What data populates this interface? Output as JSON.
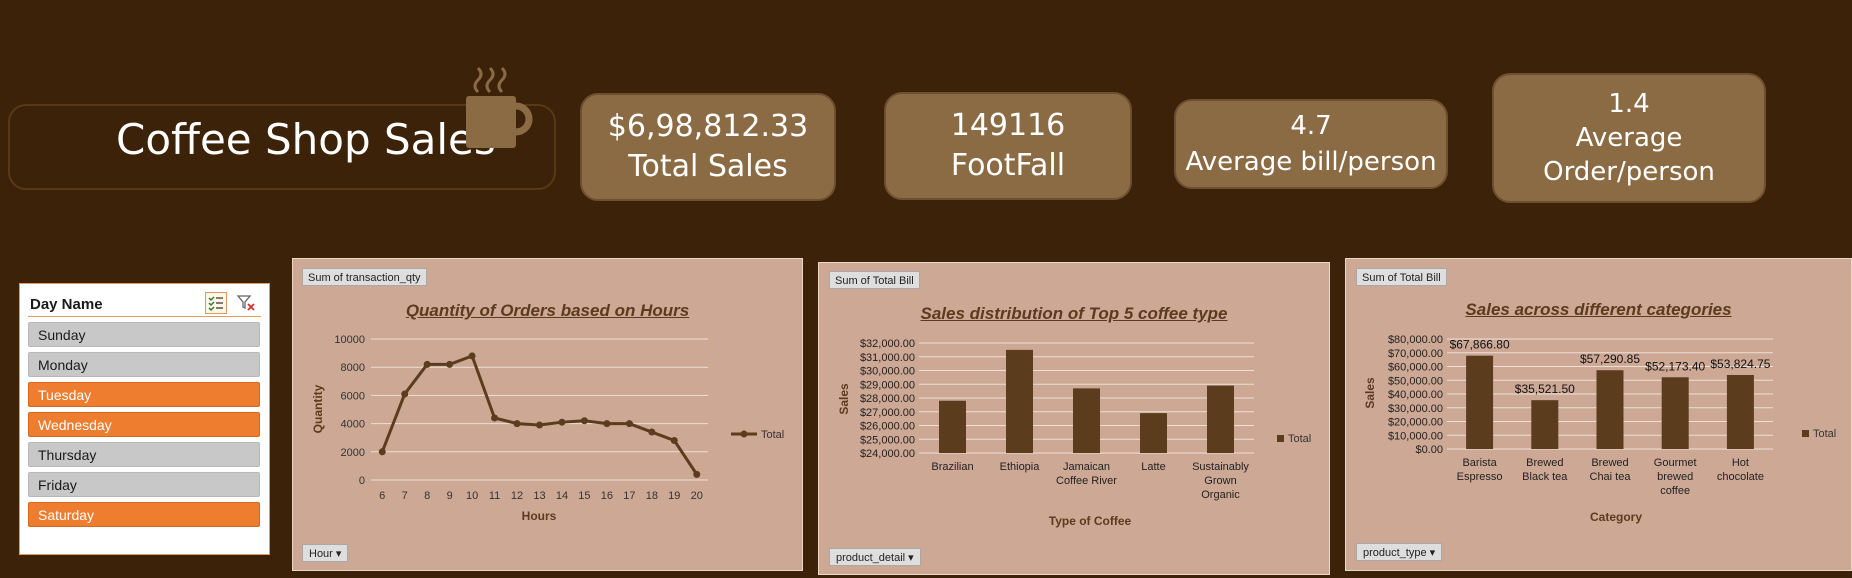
{
  "header": {
    "title": "Coffee Shop Sales",
    "kpis": [
      {
        "value": "$6,98,812.33",
        "label": "Total Sales"
      },
      {
        "value": "149116",
        "label": "FootFall"
      },
      {
        "value": "4.7",
        "label": "Average bill/person"
      },
      {
        "value": "1.4",
        "label": "Average Order/person"
      }
    ],
    "icon": "coffee-cup-icon"
  },
  "slicer": {
    "title": "Day Name",
    "items": [
      {
        "label": "Sunday",
        "selected": false
      },
      {
        "label": "Monday",
        "selected": false
      },
      {
        "label": "Tuesday",
        "selected": true
      },
      {
        "label": "Wednesday",
        "selected": true
      },
      {
        "label": "Thursday",
        "selected": false
      },
      {
        "label": "Friday",
        "selected": false
      },
      {
        "label": "Saturday",
        "selected": true
      }
    ]
  },
  "colors": {
    "background": "#3b2208",
    "kpi": "#8b6b44",
    "panel": "#cda895",
    "series": "#5b3d1e",
    "selected": "#ee7d30"
  },
  "chart_data": [
    {
      "type": "line",
      "field_button": "Sum of transaction_qty",
      "filter_button": "Hour",
      "title": "Quantity of Orders based on Hours",
      "xlabel": "Hours",
      "ylabel": "Quantity",
      "ylim": [
        0,
        10000
      ],
      "yticks": [
        "10000",
        "8000",
        "6000",
        "4000",
        "2000",
        "0"
      ],
      "legend": "right",
      "categories": [
        "6",
        "7",
        "8",
        "9",
        "10",
        "11",
        "12",
        "13",
        "14",
        "15",
        "16",
        "17",
        "18",
        "19",
        "20"
      ],
      "series": [
        {
          "name": "Total",
          "values": [
            2000,
            6100,
            8200,
            8200,
            8800,
            4400,
            4000,
            3900,
            4100,
            4200,
            4000,
            4000,
            3400,
            2800,
            400
          ]
        }
      ]
    },
    {
      "type": "bar",
      "field_button": "Sum of Total Bill",
      "filter_button": "product_detail",
      "title": "Sales distribution of Top 5 coffee type",
      "xlabel": "Type of Coffee",
      "ylabel": "Sales",
      "ylim": [
        24000,
        32000
      ],
      "yticks": [
        "$32,000.00",
        "$31,000.00",
        "$30,000.00",
        "$29,000.00",
        "$28,000.00",
        "$27,000.00",
        "$26,000.00",
        "$25,000.00",
        "$24,000.00"
      ],
      "legend": "right",
      "categories": [
        [
          "Brazilian"
        ],
        [
          "Ethiopia"
        ],
        [
          "Jamaican",
          "Coffee River"
        ],
        [
          "Latte"
        ],
        [
          "Sustainably",
          "Grown",
          "Organic"
        ]
      ],
      "series": [
        {
          "name": "Total",
          "values": [
            27800,
            31500,
            28700,
            26900,
            28900
          ]
        }
      ]
    },
    {
      "type": "bar",
      "field_button": "Sum of Total Bill",
      "filter_button": "product_type",
      "title": "Sales across different categories",
      "xlabel": "Category",
      "ylabel": "Sales",
      "ylim": [
        0,
        80000
      ],
      "yticks": [
        "$80,000.00",
        "$70,000.00",
        "$60,000.00",
        "$50,000.00",
        "$40,000.00",
        "$30,000.00",
        "$20,000.00",
        "$10,000.00",
        "$0.00"
      ],
      "legend": "right",
      "categories": [
        [
          "Barista",
          "Espresso"
        ],
        [
          "Brewed",
          "Black tea"
        ],
        [
          "Brewed",
          "Chai tea"
        ],
        [
          "Gourmet",
          "brewed",
          "coffee"
        ],
        [
          "Hot",
          "chocolate"
        ]
      ],
      "data_labels": [
        "$67,866.80",
        "$35,521.50",
        "$57,290.85",
        "$52,173.40",
        "$53,824.75"
      ],
      "series": [
        {
          "name": "Total",
          "values": [
            67866.8,
            35521.5,
            57290.85,
            52173.4,
            53824.75
          ]
        }
      ]
    }
  ]
}
